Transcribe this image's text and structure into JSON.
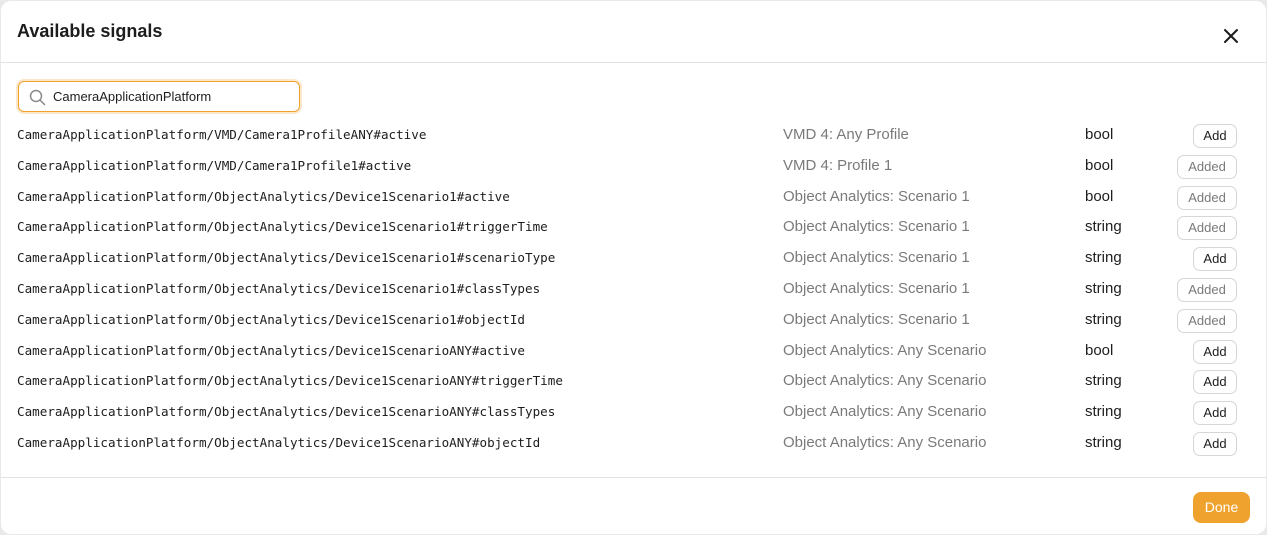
{
  "dialog": {
    "title": "Available signals",
    "close_icon": "close-icon"
  },
  "search": {
    "value": "CameraApplicationPlatform",
    "icon": "search-icon"
  },
  "signals": [
    {
      "path": "CameraApplicationPlatform/VMD/Camera1ProfileANY#active",
      "source": "VMD 4: Any Profile",
      "type": "bool",
      "action": "Add"
    },
    {
      "path": "CameraApplicationPlatform/VMD/Camera1Profile1#active",
      "source": "VMD 4: Profile 1",
      "type": "bool",
      "action": "Added"
    },
    {
      "path": "CameraApplicationPlatform/ObjectAnalytics/Device1Scenario1#active",
      "source": "Object Analytics: Scenario 1",
      "type": "bool",
      "action": "Added"
    },
    {
      "path": "CameraApplicationPlatform/ObjectAnalytics/Device1Scenario1#triggerTime",
      "source": "Object Analytics: Scenario 1",
      "type": "string",
      "action": "Added"
    },
    {
      "path": "CameraApplicationPlatform/ObjectAnalytics/Device1Scenario1#scenarioType",
      "source": "Object Analytics: Scenario 1",
      "type": "string",
      "action": "Add"
    },
    {
      "path": "CameraApplicationPlatform/ObjectAnalytics/Device1Scenario1#classTypes",
      "source": "Object Analytics: Scenario 1",
      "type": "string",
      "action": "Added"
    },
    {
      "path": "CameraApplicationPlatform/ObjectAnalytics/Device1Scenario1#objectId",
      "source": "Object Analytics: Scenario 1",
      "type": "string",
      "action": "Added"
    },
    {
      "path": "CameraApplicationPlatform/ObjectAnalytics/Device1ScenarioANY#active",
      "source": "Object Analytics: Any Scenario",
      "type": "bool",
      "action": "Add"
    },
    {
      "path": "CameraApplicationPlatform/ObjectAnalytics/Device1ScenarioANY#triggerTime",
      "source": "Object Analytics: Any Scenario",
      "type": "string",
      "action": "Add"
    },
    {
      "path": "CameraApplicationPlatform/ObjectAnalytics/Device1ScenarioANY#classTypes",
      "source": "Object Analytics: Any Scenario",
      "type": "string",
      "action": "Add"
    },
    {
      "path": "CameraApplicationPlatform/ObjectAnalytics/Device1ScenarioANY#objectId",
      "source": "Object Analytics: Any Scenario",
      "type": "string",
      "action": "Add"
    }
  ],
  "footer": {
    "done_label": "Done"
  },
  "colors": {
    "accent": "#f0a22e",
    "muted_text": "#7a7a7a",
    "text": "#1d1d1f"
  }
}
